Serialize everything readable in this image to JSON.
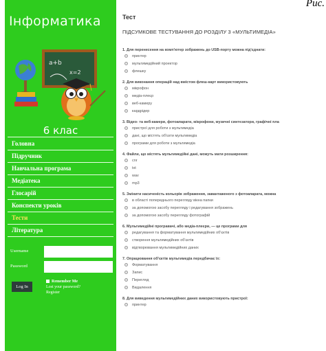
{
  "figure_caption": "Рис.",
  "sidebar": {
    "title": "Інформатика",
    "grade": "6 клас",
    "nav": [
      {
        "label": "Головна",
        "active": false
      },
      {
        "label": "Підручник",
        "active": false
      },
      {
        "label": "Навчальна програма",
        "active": false
      },
      {
        "label": "Медіатека",
        "active": false
      },
      {
        "label": "Глосарій",
        "active": false
      },
      {
        "label": "Конспекти уроків",
        "active": false
      },
      {
        "label": "Тести",
        "active": true
      },
      {
        "label": "Література",
        "active": false
      }
    ],
    "login": {
      "username_label": "Username",
      "password_label": "Password",
      "login_button": "Log In",
      "remember_me": "Remember Me",
      "lost_password": "Lost your password?",
      "register": "Register"
    }
  },
  "main": {
    "page_title": "Тест",
    "test_heading": "ПІДСУМКОВЕ ТЕСТУВАННЯ ДО РОЗДІЛУ 3 «МУЛЬТИМЕДІА»",
    "questions": [
      {
        "text": "1. Для перенесення на комп'ютер зображень до USB-порту можна під'єднати:",
        "options": [
          "принтер",
          "мультимедійний проектор",
          "флешку"
        ]
      },
      {
        "text": "2. Для виконання операцій над вмістом флеш-карт використовують",
        "options": [
          "мікрофон",
          "медіа-плеєр",
          "веб-камеру",
          "кардрідер"
        ]
      },
      {
        "text": "3. Відео- та веб-камери, фотоапарати, мікрофони, музичні синтезатори, графічні пла",
        "options": [
          "пристрої для роботи з мультимедіа",
          "дані, що містять об'єкти мультимедіа",
          "програми для роботи з мультимедіа"
        ]
      },
      {
        "text": "4. Файли, що містять мультимедійні дані, можуть мати розширення:",
        "options": [
          "cnr",
          "txt",
          "wav",
          "mp3"
        ]
      },
      {
        "text": "5. Змінити насиченість кольорів зображення, завантаженого з фотоапарата, можна",
        "options": [
          "в області попереднього перегляду вікна папки",
          "за допомогою засобу перегляду і редагування зображень",
          "за допомогою засобу перегляду фотографій"
        ]
      },
      {
        "text": "6. Мультимедійні програвачі, або медіа-плеєри, — це програми для",
        "options": [
          "редагування та форматування мультимедійних об'єктів",
          "створення мультимедійних об'єктів",
          "відтворювання мультимедійних даних"
        ]
      },
      {
        "text": "7. Опрацювання об'єктів мультимедіа передбачає їх:",
        "options": [
          "Форматування",
          "Запис",
          "Перегляд",
          "Видалення"
        ]
      },
      {
        "text": "8. Для виведення мультимедійних даних використовують пристрої:",
        "options": [
          "принтер"
        ]
      }
    ]
  },
  "colors": {
    "sidebar_green": "#2ecc1e",
    "active_nav": "#ffe25e",
    "login_button_bg": "#2d3d3a"
  },
  "icons": {
    "hero": "owl-teacher-at-chalkboard-illustration",
    "radio": "radio-button"
  }
}
